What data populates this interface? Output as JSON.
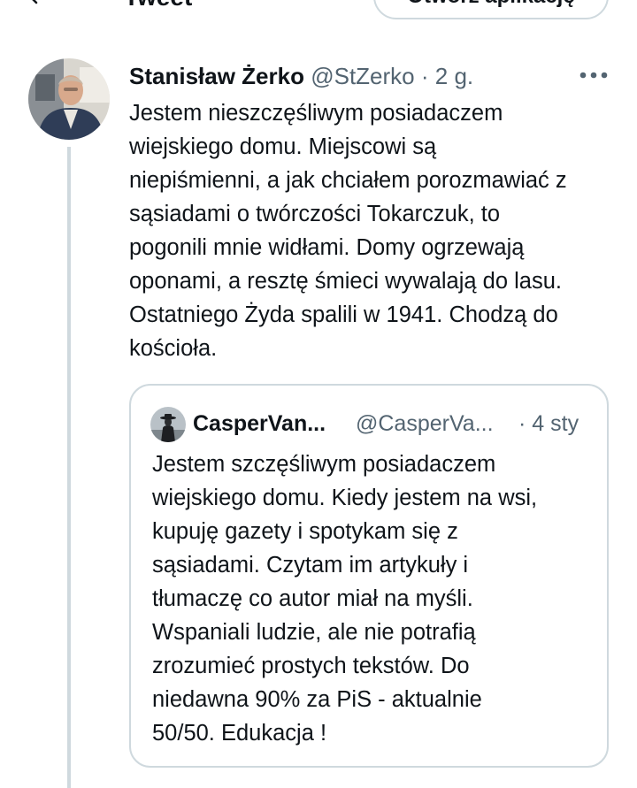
{
  "header": {
    "title": "Tweet",
    "app_button_label": "Otwórz aplikację"
  },
  "tweet": {
    "display_name": "Stanisław Żerko",
    "handle": "@StZerko",
    "separator": "·",
    "time": "2 g.",
    "more_icon": "more-horizontal-icon",
    "text_lines": [
      "Jestem nieszczęśliwym posiadaczem",
      "wiejskiego domu. Miejscowi są",
      "niepiśmienni, a jak chciałem porozmawiać z",
      "sąsiadami o twórczości Tokarczuk, to",
      "pogonili mnie widłami. Domy ogrzewają",
      "oponami, a resztę śmieci wywalają do lasu.",
      "Ostatniego Żyda spalili w 1941. Chodzą do",
      "kościoła."
    ]
  },
  "quoted_tweet": {
    "display_name": "CasperVan...",
    "handle": "@CasperVa...",
    "time": "· 4 sty",
    "text_lines": [
      "Jestem szczęśliwym posiadaczem",
      "wiejskiego domu. Kiedy jestem na wsi,",
      "kupuję gazety i spotykam się z",
      "sąsiadami. Czytam im artykuły i",
      "tłumaczę co autor miał na myśli.",
      "Wspaniali ludzie, ale nie potrafią",
      "zrozumieć prostych tekstów. Do",
      "niedawna 90% za PiS - aktualnie",
      "50/50. Edukacja !"
    ]
  },
  "colors": {
    "text_primary": "#0f1419",
    "text_secondary": "#536471",
    "border": "#cfd9de",
    "background": "#ffffff"
  }
}
